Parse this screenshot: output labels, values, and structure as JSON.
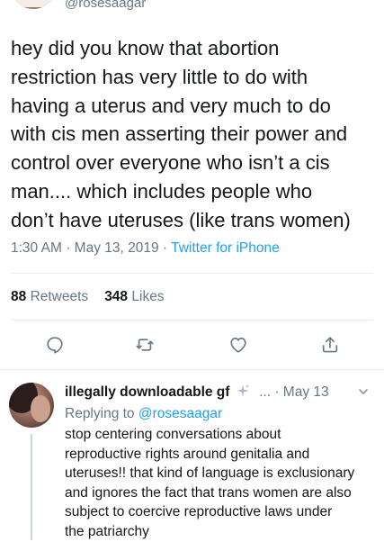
{
  "tweet": {
    "handle": "@rosesaagar",
    "text": "hey did you know that abortion\nrestriction has very little to do with\nhaving a uterus and very much to do\nwith cis men asserting their power and\ncontrol over everyone who isn’t a cis\nman.... which includes people who\ndon’t have uteruses (like trans women)",
    "time": "1:30 AM",
    "date": "May 13, 2019",
    "separator": "·",
    "source": "Twitter for iPhone",
    "retweets_count": "88",
    "retweets_label": "Retweets",
    "likes_count": "348",
    "likes_label": "Likes"
  },
  "actions": {
    "icons": [
      "reply-icon",
      "retweet-icon",
      "like-icon",
      "share-icon"
    ]
  },
  "reply": {
    "name": "illegally downloadable gf",
    "ellipsis": "...",
    "separator": "·",
    "date": "May 13",
    "replying_prefix": "Replying to",
    "replying_mention": "@rosesaagar",
    "text": "stop centering conversations about\nreproductive rights around genitalia and\nuteruses!! that kind of language is exclusionary\nand ignores the fact that trans women are also\nsubject to coercive reproductive laws under\nthe patriarchy"
  },
  "colors": {
    "text": "#14171a",
    "secondary": "#657786",
    "accent": "#1da1f2",
    "divider": "#e6ecf0"
  }
}
